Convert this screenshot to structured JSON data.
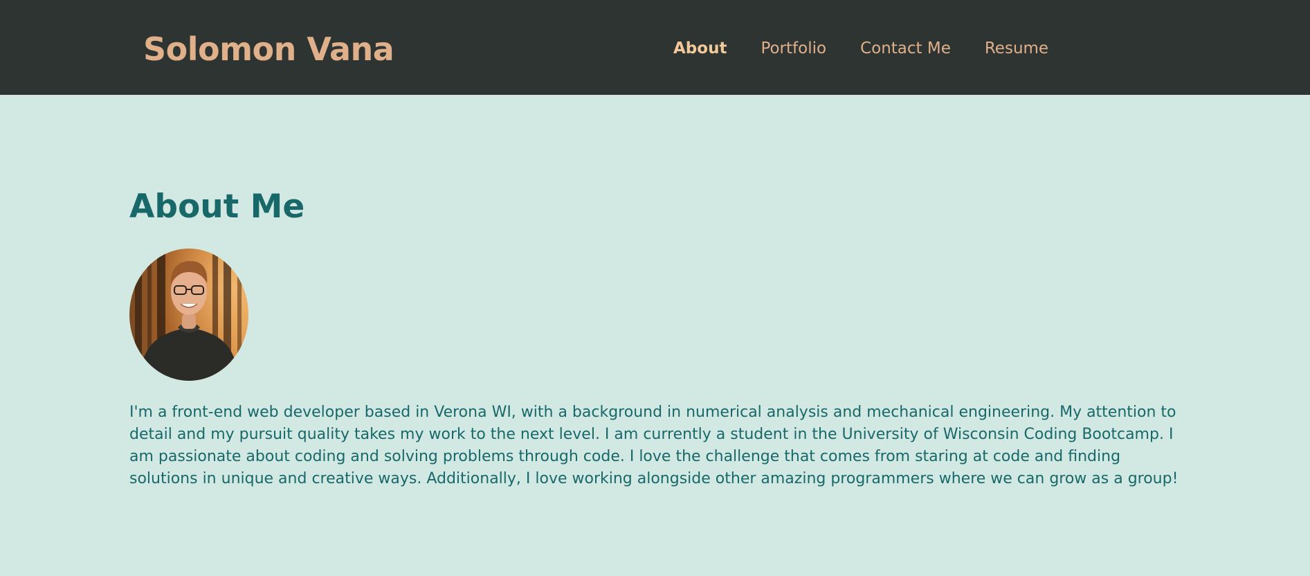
{
  "header": {
    "brand": "Solomon Vana",
    "nav": [
      {
        "label": "About",
        "active": true
      },
      {
        "label": "Portfolio",
        "active": false
      },
      {
        "label": "Contact Me",
        "active": false
      },
      {
        "label": "Resume",
        "active": false
      }
    ]
  },
  "about": {
    "title": "About Me",
    "bio": "I'm a front-end web developer based in Verona WI, with a background in numerical analysis and mechanical engineering. My attention to detail and my pursuit quality takes my work to the next level. I am currently a student in the University of Wisconsin Coding Bootcamp. I am passionate about coding and solving problems through code. I love the challenge that comes from staring at code and finding solutions in unique and creative ways. Additionally, I love working alongside other amazing programmers where we can grow as a group!"
  },
  "colors": {
    "header_bg": "#2d3432",
    "page_bg": "#d2e9e3",
    "brand": "#e0b08a",
    "heading": "#186869"
  }
}
